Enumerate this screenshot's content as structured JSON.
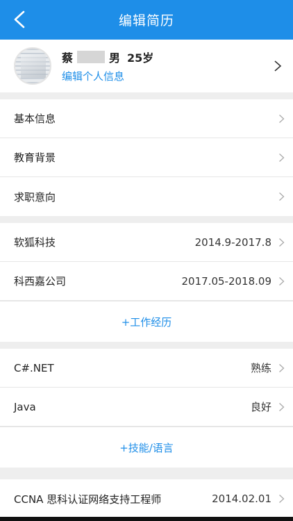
{
  "header": {
    "title": "编辑简历",
    "back_icon": "back-arrow-icon"
  },
  "profile": {
    "surname": "蔡",
    "gender": "男",
    "age": "25岁",
    "edit_link": "编辑个人信息"
  },
  "sections": {
    "basic": [
      {
        "label": "基本信息"
      },
      {
        "label": "教育背景"
      },
      {
        "label": "求职意向"
      }
    ],
    "work": [
      {
        "label": "软狐科技",
        "value": "2014.9-2017.8"
      },
      {
        "label": "科西嘉公司",
        "value": "2017.05-2018.09"
      }
    ],
    "work_add": "+工作经历",
    "skills": [
      {
        "label": "C#.NET",
        "value": "熟练"
      },
      {
        "label": "Java",
        "value": "良好"
      }
    ],
    "skills_add": "+技能/语言",
    "certs": [
      {
        "label": "CCNA 思科认证网络支持工程师",
        "value": "2014.02.01"
      }
    ]
  },
  "colors": {
    "accent": "#1e8ee8",
    "background": "#eeeeee"
  }
}
